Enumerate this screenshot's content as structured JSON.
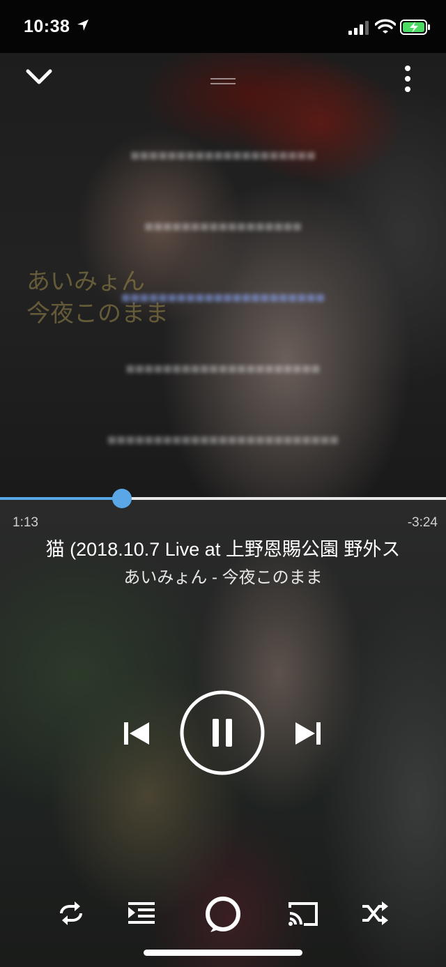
{
  "status_bar": {
    "time": "10:38",
    "icons": [
      "location-arrow-icon",
      "cellular-signal-icon",
      "wifi-icon",
      "battery-charging-icon"
    ]
  },
  "artwork": {
    "text_lines": [
      "あいみょん",
      "今夜このまま"
    ],
    "lyrics": [
      {
        "text": "■■■■■■■■■■■■■■■■■■■■",
        "active": false
      },
      {
        "text": "■■■■■■■■■■■■■■■■■",
        "active": false
      },
      {
        "text": "■■■■■■■■■■■■■■■■■■■■■■",
        "active": true
      },
      {
        "text": "■■■■■■■■■■■■■■■■■■■■■",
        "active": false
      },
      {
        "text": "■■■■■■■■■■■■■■■■■■■■■■■■■",
        "active": false
      }
    ],
    "icons": [
      "chevron-down-icon",
      "drag-handle-icon",
      "more-vertical-icon"
    ]
  },
  "playback": {
    "elapsed": "1:13",
    "remaining": "-3:24",
    "progress": 0.273,
    "accent_color": "#5aa7e8"
  },
  "track": {
    "title": "猫 (2018.10.7 Live at 上野恩賜公園 野外ス",
    "artist_album": "あいみょん - 今夜このまま"
  },
  "controls": {
    "icons": [
      "previous-track-icon",
      "pause-icon",
      "next-track-icon",
      "repeat-icon",
      "queue-icon",
      "alexa-icon",
      "cast-icon",
      "shuffle-icon"
    ]
  }
}
